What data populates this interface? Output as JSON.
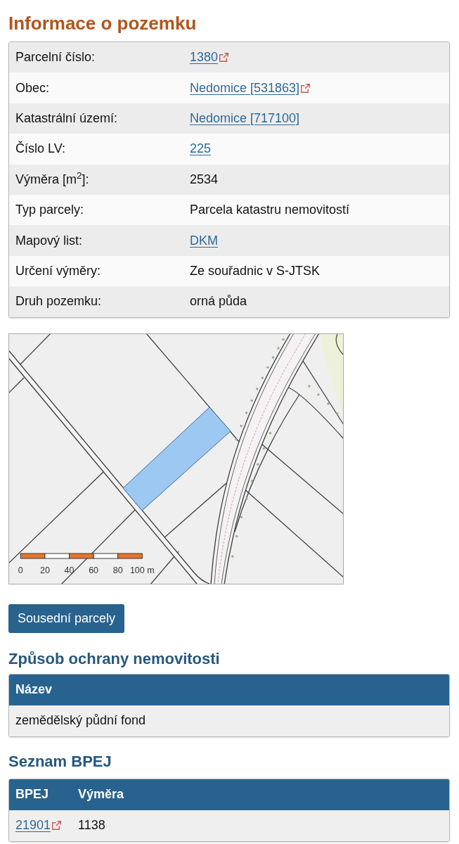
{
  "title": "Informace o pozemku",
  "parcel_info": {
    "rows": [
      {
        "label": "Parcelní číslo:",
        "value": "1380",
        "kind": "external_link"
      },
      {
        "label": "Obec:",
        "value": "Nedomice [531863]",
        "kind": "external_link"
      },
      {
        "label": "Katastrální území:",
        "value": "Nedomice [717100]",
        "kind": "link"
      },
      {
        "label": "Číslo LV:",
        "value": "225",
        "kind": "link"
      },
      {
        "label": "Výměra [m$^{2}$]:",
        "value": "2534",
        "kind": "text"
      },
      {
        "label": "Typ parcely:",
        "value": "Parcela katastru nemovitostí",
        "kind": "text"
      },
      {
        "label": "Mapový list:",
        "value": "DKM",
        "kind": "link"
      },
      {
        "label": "Určení výměry:",
        "value": "Ze souřadnic v S-JTSK",
        "kind": "text"
      },
      {
        "label": "Druh pozemku:",
        "value": "orná půda",
        "kind": "text"
      }
    ]
  },
  "map": {
    "scale_labels": [
      "0",
      "20",
      "40",
      "60",
      "80",
      "100 m"
    ]
  },
  "neighbor_parcels_button": "Sousední parcely",
  "protection": {
    "heading": "Způsob ochrany nemovitosti",
    "columns": [
      "Název"
    ],
    "rows": [
      [
        {
          "text": "zemědělský půdní fond",
          "kind": "text"
        }
      ]
    ]
  },
  "bpej": {
    "heading": "Seznam BPEJ",
    "columns": [
      "BPEJ",
      "Výměra"
    ],
    "rows": [
      [
        {
          "text": "21901",
          "kind": "external_link"
        },
        {
          "text": "1138",
          "kind": "text"
        }
      ]
    ]
  }
}
